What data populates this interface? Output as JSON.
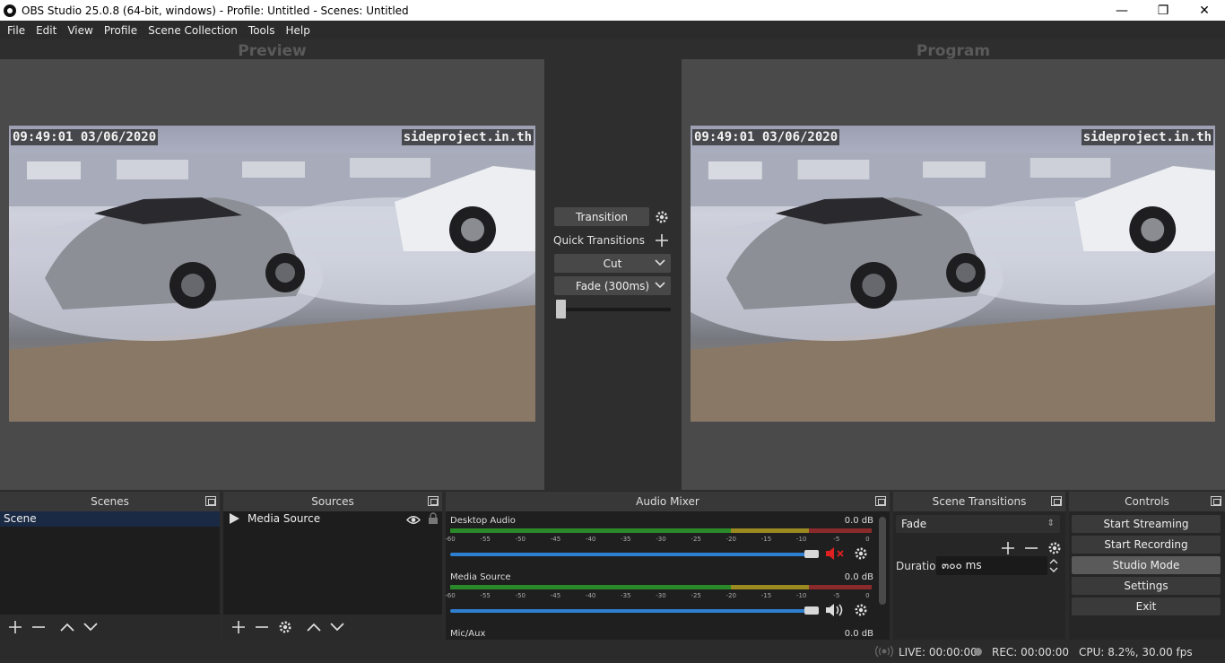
{
  "window": {
    "title": "OBS Studio 25.0.8 (64-bit, windows) - Profile: Untitled - Scenes: Untitled",
    "minimize": "—",
    "restore": "❐",
    "close": "✕"
  },
  "menu": [
    "File",
    "Edit",
    "View",
    "Profile",
    "Scene Collection",
    "Tools",
    "Help"
  ],
  "preview": {
    "label": "Preview",
    "timestamp": "09:49:01 03/06/2020",
    "watermark": "sideproject.in.th"
  },
  "program": {
    "label": "Program",
    "timestamp": "09:49:01 03/06/2020",
    "watermark": "sideproject.in.th"
  },
  "transition_panel": {
    "transition_label": "Transition",
    "quick_transitions_label": "Quick Transitions",
    "cut_label": "Cut",
    "fade_label": "Fade (300ms)",
    "tbar_level": 0
  },
  "scenes": {
    "title": "Scenes",
    "items": [
      "Scene"
    ]
  },
  "sources": {
    "title": "Sources",
    "items": [
      "Media Source"
    ]
  },
  "mixer": {
    "title": "Audio Mixer",
    "channels": [
      {
        "name": "Desktop Audio",
        "db": "0.0 dB",
        "muted": true
      },
      {
        "name": "Media Source",
        "db": "0.0 dB",
        "muted": false
      },
      {
        "name": "Mic/Aux",
        "db": "0.0 dB",
        "muted": false
      }
    ],
    "ticks": [
      "-60",
      "-55",
      "-50",
      "-45",
      "-40",
      "-35",
      "-30",
      "-25",
      "-20",
      "-15",
      "-10",
      "-5",
      "0"
    ]
  },
  "scene_transitions": {
    "title": "Scene Transitions",
    "selected": "Fade",
    "duration_label": "Duration",
    "duration_value": "๓๐๐ ms"
  },
  "controls": {
    "title": "Controls",
    "start_streaming": "Start Streaming",
    "start_recording": "Start Recording",
    "studio_mode": "Studio Mode",
    "settings": "Settings",
    "exit": "Exit"
  },
  "status": {
    "live": "LIVE: 00:00:00",
    "rec": "REC: 00:00:00",
    "cpu": "CPU: 8.2%, 30.00 fps"
  },
  "colors": {
    "accent_blue": "#2f7fd0",
    "mute_red": "#e02020",
    "meter_green": "#2a8a2a",
    "meter_yellow": "#9a8a20",
    "meter_red": "#8a2a2a"
  }
}
